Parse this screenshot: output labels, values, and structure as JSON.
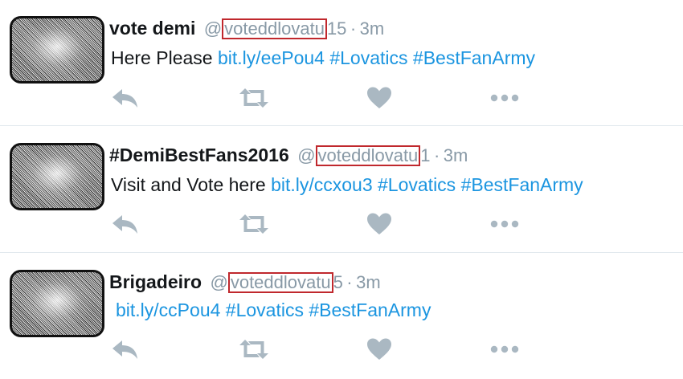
{
  "tweets": [
    {
      "name": "vote demi",
      "handle_at": "@",
      "handle_boxed": "voteddlovatu",
      "handle_suffix": "15",
      "separator": "·",
      "time": "3m",
      "text_prefix": "Here Please",
      "link": "bit.ly/eePou4",
      "hashtags": [
        "#Lovatics",
        "#BestFanArmy"
      ]
    },
    {
      "name": "#DemiBestFans2016",
      "handle_at": "@",
      "handle_boxed": "voteddlovatu",
      "handle_suffix": "1",
      "separator": "·",
      "time": "3m",
      "text_prefix": "Visit and Vote here",
      "link": "bit.ly/ccxou3",
      "hashtags": [
        "#Lovatics",
        "#BestFanArmy"
      ]
    },
    {
      "name": "Brigadeiro",
      "handle_at": "@",
      "handle_boxed": "voteddlovatu",
      "handle_suffix": "5",
      "separator": "·",
      "time": "3m",
      "text_prefix": "",
      "link": "bit.ly/ccPou4",
      "hashtags": [
        "#Lovatics",
        "#BestFanArmy"
      ]
    }
  ],
  "icons": {
    "reply": "reply-icon",
    "retweet": "retweet-icon",
    "like": "heart-icon",
    "more": "more-icon"
  },
  "colors": {
    "link": "#1b95e0",
    "muted": "#8899a6",
    "icon": "#aab8c2",
    "highlight_box": "#c0282d"
  }
}
